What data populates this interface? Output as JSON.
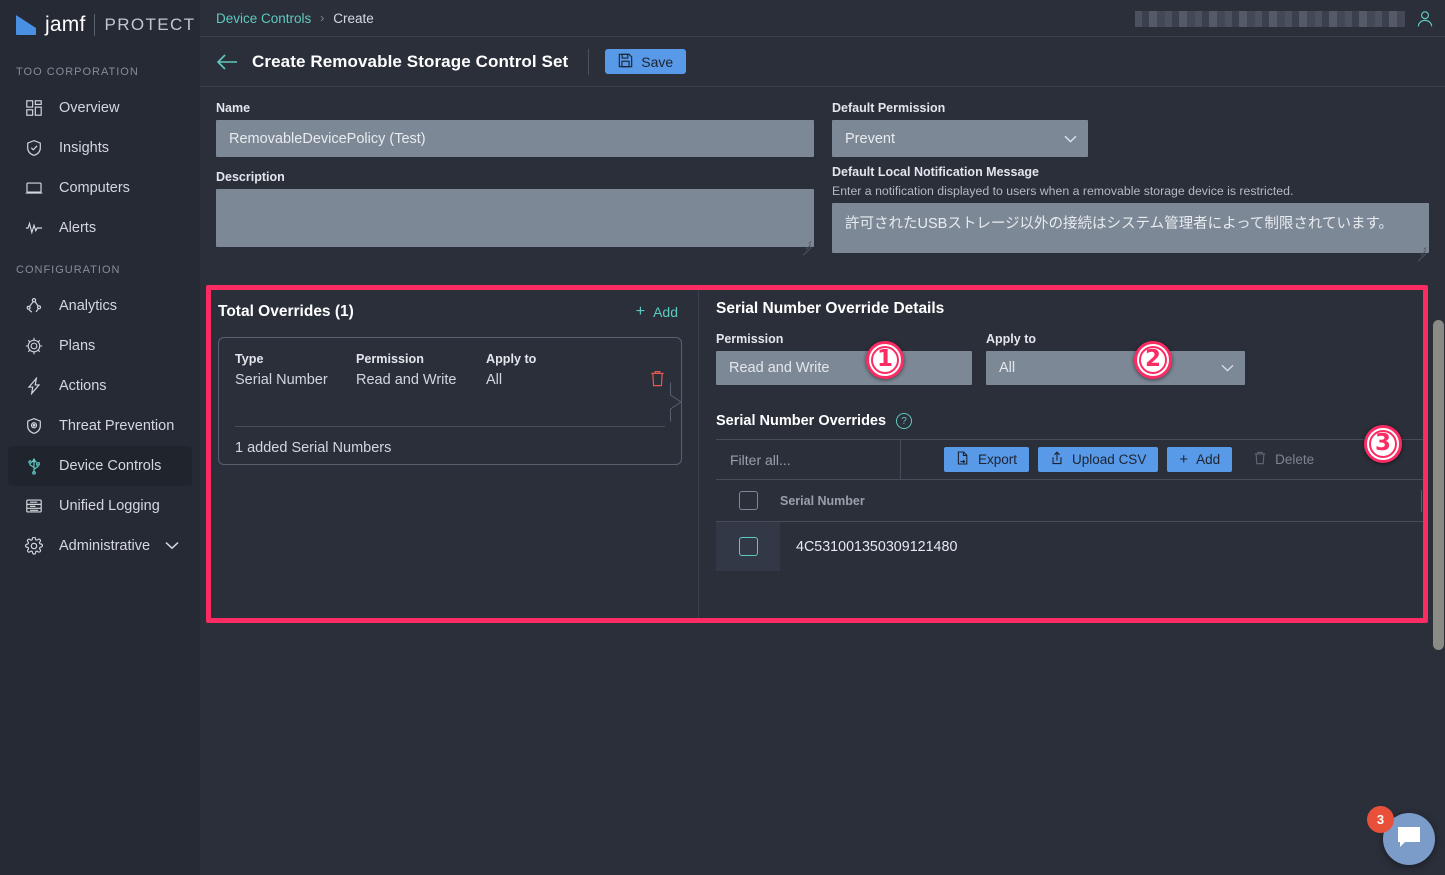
{
  "brand": {
    "name": "jamf",
    "product": "PROTECT"
  },
  "sidebar": {
    "sections": [
      {
        "label": "TOO CORPORATION",
        "items": [
          {
            "label": "Overview",
            "icon": "dashboard-icon"
          },
          {
            "label": "Insights",
            "icon": "shield-check-icon"
          },
          {
            "label": "Computers",
            "icon": "laptop-icon"
          },
          {
            "label": "Alerts",
            "icon": "pulse-icon"
          }
        ]
      },
      {
        "label": "CONFIGURATION",
        "items": [
          {
            "label": "Analytics",
            "icon": "analytics-icon"
          },
          {
            "label": "Plans",
            "icon": "plans-gear-icon"
          },
          {
            "label": "Actions",
            "icon": "bolt-icon"
          },
          {
            "label": "Threat Prevention",
            "icon": "shield-target-icon"
          },
          {
            "label": "Device Controls",
            "icon": "usb-icon"
          },
          {
            "label": "Unified Logging",
            "icon": "logs-icon"
          },
          {
            "label": "Administrative",
            "icon": "gear-icon"
          }
        ]
      }
    ],
    "active": "Device Controls"
  },
  "breadcrumb": {
    "parent": "Device Controls",
    "separator": "›",
    "current": "Create"
  },
  "header": {
    "title": "Create Removable Storage Control Set",
    "save_label": "Save",
    "back_icon": "back-arrow-icon",
    "save_icon": "floppy-disk-icon",
    "user_icon": "user-avatar-icon"
  },
  "form": {
    "name_label": "Name",
    "name_value": "RemovableDevicePolicy (Test)",
    "description_label": "Description",
    "description_value": "",
    "default_permission_label": "Default Permission",
    "default_permission_value": "Prevent",
    "notification_label": "Default Local Notification Message",
    "notification_hint": "Enter a notification displayed to users when a removable storage device is restricted.",
    "notification_value": "許可されたUSBストレージ以外の接続はシステム管理者によって制限されています。"
  },
  "overrides_panel": {
    "title": "Total Overrides (1)",
    "add_label": "Add",
    "columns": {
      "type": "Type",
      "permission": "Permission",
      "apply_to": "Apply to"
    },
    "card": {
      "type": "Serial Number",
      "permission": "Read and Write",
      "apply_to": "All",
      "footer": "1 added Serial Numbers",
      "delete_icon": "trash-icon"
    }
  },
  "details_panel": {
    "title": "Serial Number Override Details",
    "permission_label": "Permission",
    "permission_value": "Read and Write",
    "apply_to_label": "Apply to",
    "apply_to_value": "All",
    "overrides_title": "Serial Number Overrides",
    "help_icon": "help-circle-icon",
    "filter_placeholder": "Filter all...",
    "buttons": {
      "export": "Export",
      "upload_csv": "Upload CSV",
      "add": "Add",
      "delete": "Delete"
    },
    "table": {
      "header": "Serial Number",
      "rows": [
        {
          "serial": "4C531001350309121480",
          "checked": false
        }
      ]
    }
  },
  "markers": [
    {
      "id": "1",
      "glyph": "①"
    },
    {
      "id": "2",
      "glyph": "②"
    },
    {
      "id": "3",
      "glyph": "③"
    }
  ],
  "marker_labels": {
    "one": "1",
    "two": "2",
    "three": "3"
  },
  "chat": {
    "badge": "3",
    "icon": "chat-bubble-icon"
  },
  "colors": {
    "accent_teal": "#5fc9c0",
    "accent_blue": "#5899e8",
    "highlight_pink": "#fb2c64",
    "danger_red": "#e8584f",
    "bg_main": "#2a2f3a",
    "bg_sidebar": "#252a34",
    "field_bg": "#7d8896"
  }
}
